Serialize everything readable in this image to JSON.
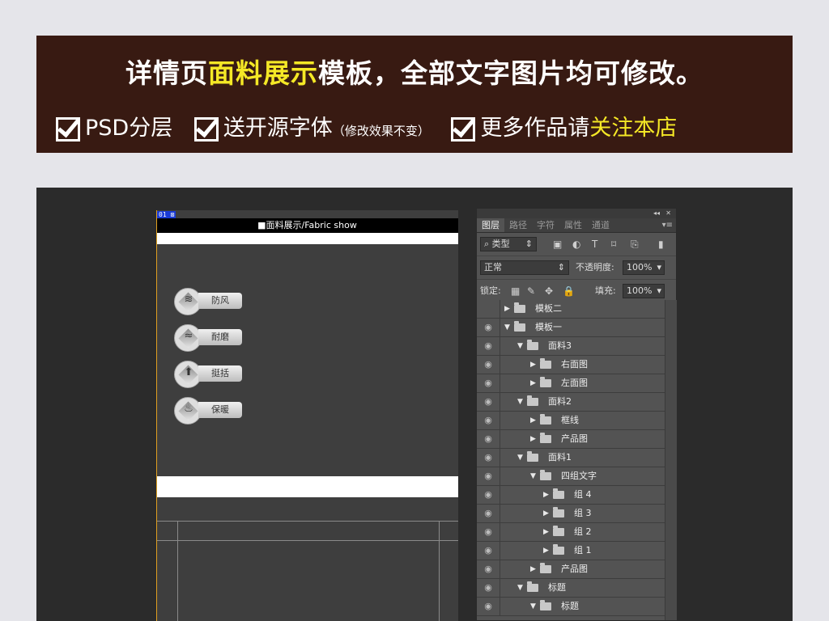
{
  "banner": {
    "headline_pre": "详情页",
    "headline_hl": "面料展示",
    "headline_post": "模板，全部文字图片均可修改。",
    "features": [
      {
        "text": "PSD分层"
      },
      {
        "text": "送开源字体",
        "note": "（修改效果不变）"
      },
      {
        "text_pre": "更多作品请",
        "text_hl": "关注本店"
      }
    ],
    "accent_color": "#f5e826",
    "background_color": "#381a12"
  },
  "canvas": {
    "tag": "01 ⊠",
    "title": "■面料展示/Fabric show",
    "features": [
      {
        "label": "防风",
        "icon": "wind-icon",
        "glyph": "≋"
      },
      {
        "label": "耐磨",
        "icon": "wave-icon",
        "glyph": "≈"
      },
      {
        "label": "挺括",
        "icon": "arrow-up-box-icon",
        "glyph": "⬆"
      },
      {
        "label": "保暖",
        "icon": "flame-icon",
        "glyph": "♨"
      }
    ]
  },
  "panel": {
    "tabs": [
      "图层",
      "路径",
      "字符",
      "属性",
      "通道"
    ],
    "filter_label": "⌕ 类型",
    "blend_mode": "正常",
    "opacity_label": "不透明度:",
    "opacity_value": "100%",
    "lock_label": "锁定:",
    "fill_label": "填充:",
    "fill_value": "100%",
    "layers": [
      {
        "name": "模板二",
        "indent": 0,
        "expanded": false,
        "visible": false
      },
      {
        "name": "模板一",
        "indent": 0,
        "expanded": true,
        "visible": true
      },
      {
        "name": "面料3",
        "indent": 1,
        "expanded": true,
        "visible": true
      },
      {
        "name": "右面图",
        "indent": 2,
        "expanded": false,
        "visible": true
      },
      {
        "name": "左面图",
        "indent": 2,
        "expanded": false,
        "visible": true
      },
      {
        "name": "面料2",
        "indent": 1,
        "expanded": true,
        "visible": true
      },
      {
        "name": "框线",
        "indent": 2,
        "expanded": false,
        "visible": true
      },
      {
        "name": "产品图",
        "indent": 2,
        "expanded": false,
        "visible": true
      },
      {
        "name": "面料1",
        "indent": 1,
        "expanded": true,
        "visible": true
      },
      {
        "name": "四组文字",
        "indent": 2,
        "expanded": true,
        "visible": true
      },
      {
        "name": "组 4",
        "indent": 3,
        "expanded": false,
        "visible": true
      },
      {
        "name": "组 3",
        "indent": 3,
        "expanded": false,
        "visible": true
      },
      {
        "name": "组 2",
        "indent": 3,
        "expanded": false,
        "visible": true
      },
      {
        "name": "组 1",
        "indent": 3,
        "expanded": false,
        "visible": true
      },
      {
        "name": "产品图",
        "indent": 2,
        "expanded": false,
        "visible": true
      },
      {
        "name": "标题",
        "indent": 1,
        "expanded": true,
        "visible": true
      },
      {
        "name": "标题",
        "indent": 2,
        "expanded": true,
        "visible": true
      }
    ]
  }
}
